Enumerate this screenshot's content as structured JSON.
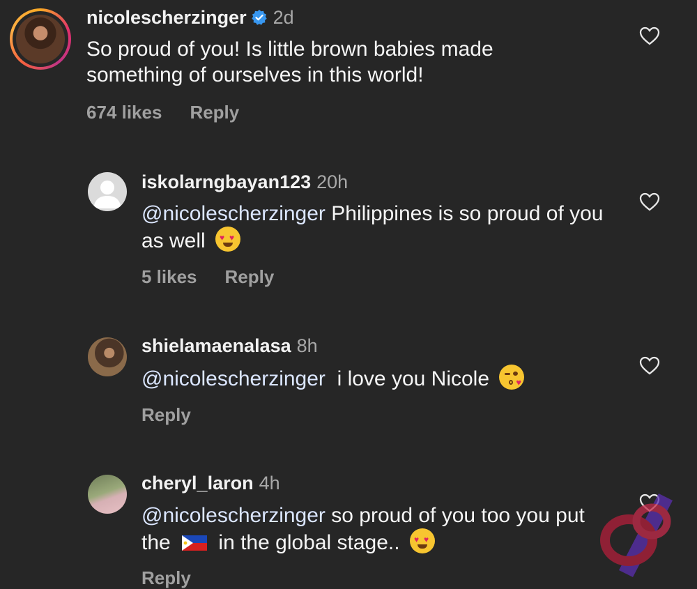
{
  "comments": [
    {
      "username": "nicolescherzinger",
      "time": "2d",
      "verified": true,
      "text": "So proud of you! Is little brown babies made something of ourselves in this world!",
      "likes": "674 likes",
      "reply": "Reply"
    },
    {
      "username": "iskolarngbayan123",
      "time": "20h",
      "mention": "@nicolescherzinger",
      "text": "Philippines is so proud of you as well",
      "emoji": "heart-eyes-emoji",
      "likes": "5 likes",
      "reply": "Reply"
    },
    {
      "username": "shielamaenalasa",
      "time": "8h",
      "mention": "@nicolescherzinger",
      "text": "i love you Nicole",
      "emoji": "kissing-heart-emoji",
      "reply": "Reply"
    },
    {
      "username": "cheryl_laron",
      "time": "4h",
      "mention": "@nicolescherzinger",
      "text_before_flag": "so proud of you too you put the",
      "flag": "philippines-flag",
      "text_after_flag": "in the global stage..",
      "emoji": "heart-eyes-emoji",
      "reply": "Reply"
    }
  ],
  "colors": {
    "background": "#262626",
    "verified_badge": "#3897f0",
    "secondary_text": "#a8a8a8"
  }
}
